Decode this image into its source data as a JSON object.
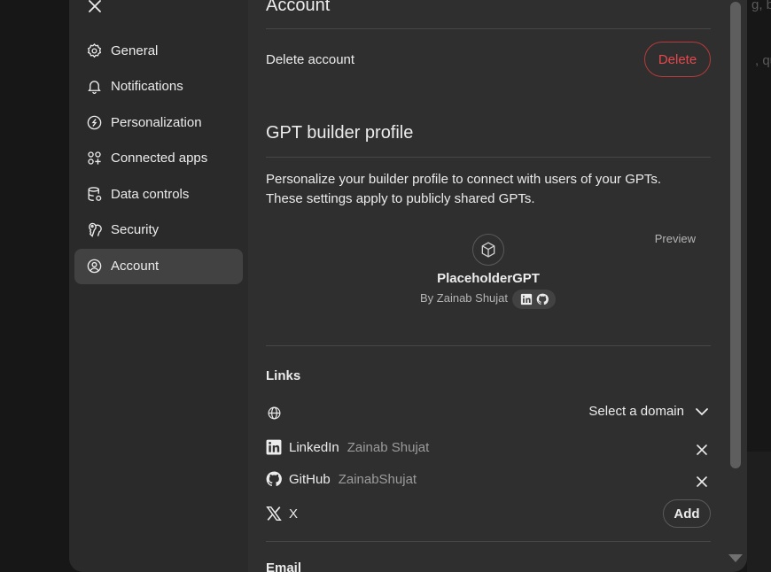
{
  "background": {
    "snippet_top": "g, be",
    "snippet_mid": ", qu"
  },
  "sidebar": {
    "items": [
      {
        "label": "General",
        "icon": "gear-icon"
      },
      {
        "label": "Notifications",
        "icon": "bell-icon"
      },
      {
        "label": "Personalization",
        "icon": "personalization-icon"
      },
      {
        "label": "Connected apps",
        "icon": "apps-icon"
      },
      {
        "label": "Data controls",
        "icon": "database-icon"
      },
      {
        "label": "Security",
        "icon": "key-icon"
      },
      {
        "label": "Account",
        "icon": "user-circle-icon",
        "active": true
      }
    ]
  },
  "account": {
    "title": "Account",
    "delete_label": "Delete account",
    "delete_button": "Delete"
  },
  "builder_profile": {
    "title": "GPT builder profile",
    "description_line1": "Personalize your builder profile to connect with users of your GPTs.",
    "description_line2": "These settings apply to publicly shared GPTs.",
    "preview_label": "Preview",
    "gpt_name": "PlaceholderGPT",
    "gpt_by": "By Zainab Shujat"
  },
  "links": {
    "title": "Links",
    "domain_select": "Select a domain",
    "items": [
      {
        "name": "LinkedIn",
        "value": "Zainab Shujat",
        "icon": "linkedin-icon"
      },
      {
        "name": "GitHub",
        "value": "ZainabShujat",
        "icon": "github-icon"
      },
      {
        "name": "X",
        "value": "",
        "icon": "x-logo-icon"
      }
    ],
    "add_button": "Add"
  },
  "next_section_title": "Email",
  "colors": {
    "modal_bg": "#2f2f2f",
    "sidebar_bg": "#2a2a2a",
    "active_item_bg": "#424242",
    "danger": "#e5484d"
  }
}
